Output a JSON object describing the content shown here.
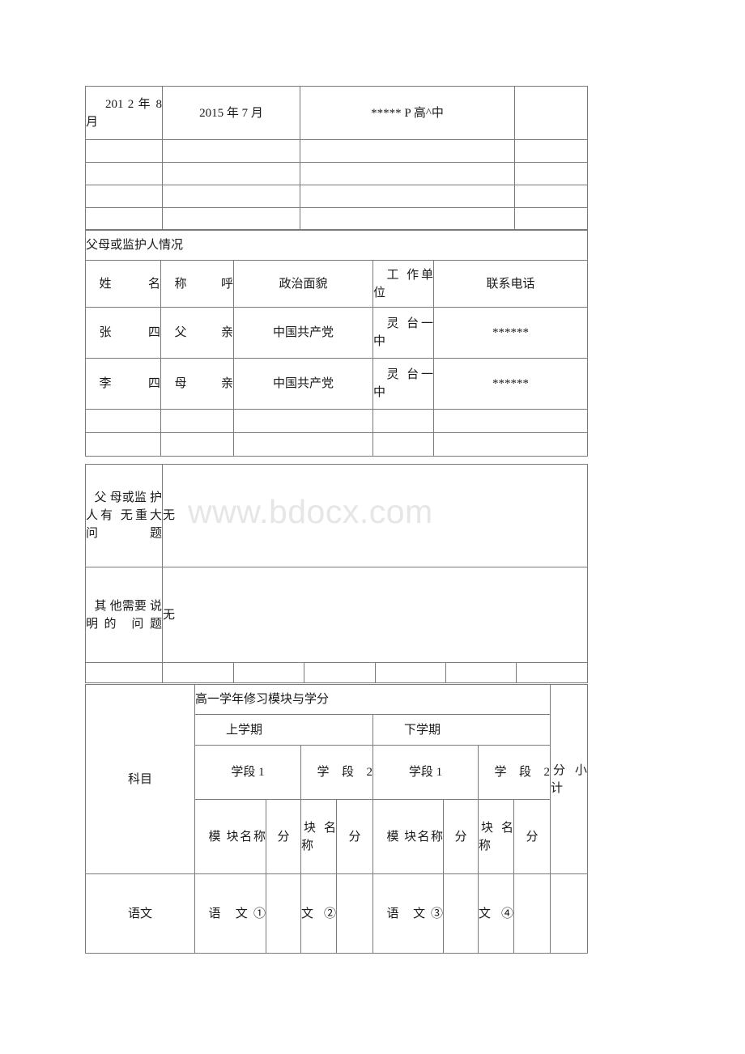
{
  "document": {
    "watermark": "www.bdocx.com"
  },
  "top_table": {
    "rows": [
      {
        "c1": "201 2 年 8 月",
        "c2": "2015 年 7 月",
        "c3": "***** P 高^中",
        "c4": ""
      },
      {
        "c1": "",
        "c2": "",
        "c3": "",
        "c4": ""
      },
      {
        "c1": "",
        "c2": "",
        "c3": "",
        "c4": ""
      },
      {
        "c1": "",
        "c2": "",
        "c3": "",
        "c4": ""
      },
      {
        "c1": "",
        "c2": "",
        "c3": "",
        "c4": ""
      }
    ]
  },
  "guardian": {
    "section_title": "父母或监护人情况",
    "headers": {
      "name": "姓 名",
      "relation": "称 呼",
      "political": "政治面貌",
      "workplace": "工 作单位",
      "phone": "联系电话"
    },
    "rows": [
      {
        "name": "张 四",
        "relation": "父 亲",
        "political": "中国共产党",
        "workplace": "灵 台一中",
        "phone": "******"
      },
      {
        "name": "李 四",
        "relation": "母 亲",
        "political": "中国共产党",
        "workplace": "灵 台一中",
        "phone": "******"
      },
      {
        "name": "",
        "relation": "",
        "political": "",
        "workplace": "",
        "phone": ""
      },
      {
        "name": "",
        "relation": "",
        "political": "",
        "workplace": "",
        "phone": ""
      }
    ]
  },
  "notes": [
    {
      "label": "父 母或监 护 人有 无重大 问题",
      "value": "无"
    },
    {
      "label": "其 他需要 说 明的 问题",
      "value": "无"
    }
  ],
  "credits": {
    "title": "高一学年修习模块与学分",
    "subject_label": "科目",
    "total_label": "分 小 计",
    "terms": [
      {
        "label": "上学期",
        "periods": [
          {
            "label": "学段 1"
          },
          {
            "label": "学 段 2"
          }
        ]
      },
      {
        "label": "下学期",
        "periods": [
          {
            "label": "学段 1"
          },
          {
            "label": "学 段 2"
          }
        ]
      }
    ],
    "column_headers": {
      "module_wide": "模 块名称",
      "module_narrow": "块 名 称",
      "credit": "分"
    },
    "rows": [
      {
        "subject": "语文",
        "t1_module": "语 文①",
        "t1_credit": "",
        "t2_module": "文 ②",
        "t2_credit": "",
        "t3_module": "语 文③",
        "t3_credit": "",
        "t4_module": "文 ④",
        "t4_credit": "",
        "total": ""
      }
    ]
  }
}
